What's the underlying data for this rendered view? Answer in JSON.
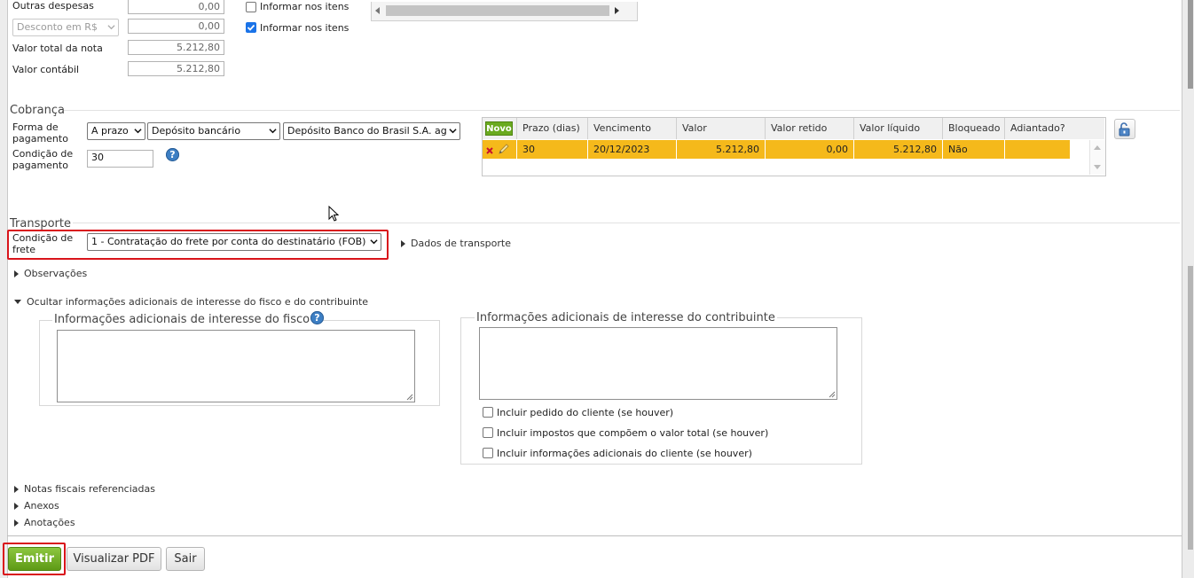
{
  "totals": {
    "outras_despesas_label": "Outras despesas",
    "outras_despesas_value": "0,00",
    "desconto_select": "Desconto em R$",
    "desconto_value": "0,00",
    "valor_total_label": "Valor total da nota",
    "valor_total_value": "5.212,80",
    "valor_contabil_label": "Valor contábil",
    "valor_contabil_value": "5.212,80"
  },
  "informar_itens": [
    {
      "label": "Informar nos itens",
      "checked": false
    },
    {
      "label": "Informar nos itens",
      "checked": true
    }
  ],
  "cobranca": {
    "title": "Cobrança",
    "forma_label_1": "Forma de",
    "forma_label_2": "pagamento",
    "prazo_select": "A prazo",
    "tipo_select": "Depósito bancário",
    "banco_select": "Depósito Banco do Brasil S.A. ag",
    "condicao_label_1": "Condição de",
    "condicao_label_2": "pagamento",
    "condicao_value": "30",
    "help_icon": "?",
    "grid": {
      "new_button": "Novo",
      "columns": [
        "Prazo (dias)",
        "Vencimento",
        "Valor",
        "Valor retido",
        "Valor líquido",
        "Bloqueado",
        "Adiantado?"
      ],
      "rows": [
        {
          "prazo": "30",
          "vencimento": "20/12/2023",
          "valor": "5.212,80",
          "retido": "0,00",
          "liquido": "5.212,80",
          "bloqueado": "Não",
          "adiantado": ""
        }
      ]
    }
  },
  "transporte": {
    "title": "Transporte",
    "frete_label_1": "Condição de",
    "frete_label_2": "frete",
    "frete_select": "1 - Contratação do frete por conta do destinatário (FOB)",
    "dados_link": "Dados de transporte"
  },
  "observacoes_toggle": "Observações",
  "info_toggle": "Ocultar informações adicionais de interesse do fisco e do contribuinte",
  "fisco": {
    "legend": "Informações adicionais de interesse do fisco",
    "help_icon": "?"
  },
  "contribuinte": {
    "legend": "Informações adicionais de interesse do contribuinte",
    "options": [
      {
        "label": "Incluir pedido do cliente (se houver)",
        "checked": false
      },
      {
        "label": "Incluir impostos que compõem o valor total (se houver)",
        "checked": false
      },
      {
        "label": "Incluir informações adicionais do cliente (se houver)",
        "checked": false
      }
    ]
  },
  "collapsed_sections": [
    "Notas fiscais referenciadas",
    "Anexos",
    "Anotações"
  ],
  "actions": {
    "emitir": "Emitir",
    "visualizar_pdf": "Visualizar PDF",
    "sair": "Sair"
  },
  "colors": {
    "accent_green": "#6aaa1f",
    "row_highlight": "#f5b91b",
    "annotation_red": "#d9141b",
    "help_blue": "#3d7fc4"
  }
}
